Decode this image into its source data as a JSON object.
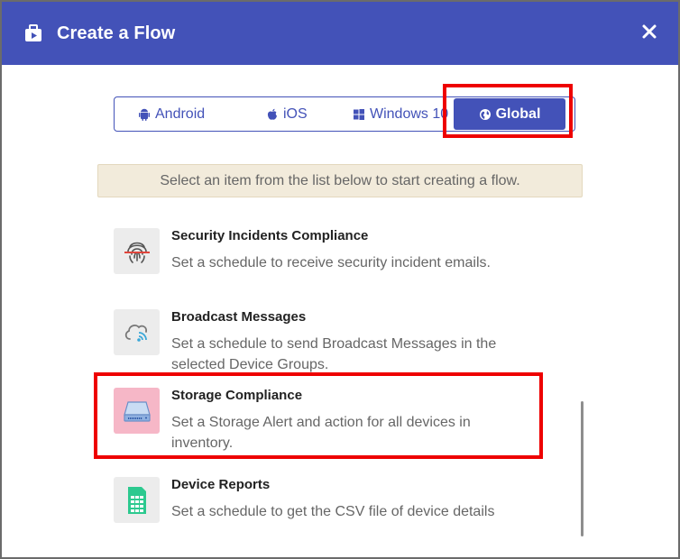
{
  "dialog": {
    "title": "Create a Flow",
    "close_label": "×"
  },
  "tabs": [
    {
      "label": "Android",
      "icon": "android-icon"
    },
    {
      "label": "iOS",
      "icon": "apple-icon"
    },
    {
      "label": "Windows 10",
      "icon": "windows-icon"
    },
    {
      "label": "Global",
      "icon": "globe-icon",
      "selected": true
    }
  ],
  "info": "Select an item from the list below to start creating a flow.",
  "items": [
    {
      "title": "Security Incidents Compliance",
      "description": "Set a schedule to receive security incident emails.",
      "icon": "fingerprint-icon"
    },
    {
      "title": "Broadcast Messages",
      "description": "Set a schedule to send Broadcast Messages in the selected Device Groups.",
      "icon": "cloud-broadcast-icon"
    },
    {
      "title": "Storage Compliance",
      "description": "Set a Storage Alert and action for all devices in inventory.",
      "icon": "storage-drive-icon"
    },
    {
      "title": "Device Reports",
      "description": "Set a schedule to get the CSV file of device details",
      "icon": "report-sheet-icon"
    }
  ],
  "colors": {
    "header": "#4352b8",
    "highlight": "#ee0000",
    "info_bg": "#f2ebdb",
    "storage_icon_bg": "#f6b7c7"
  }
}
